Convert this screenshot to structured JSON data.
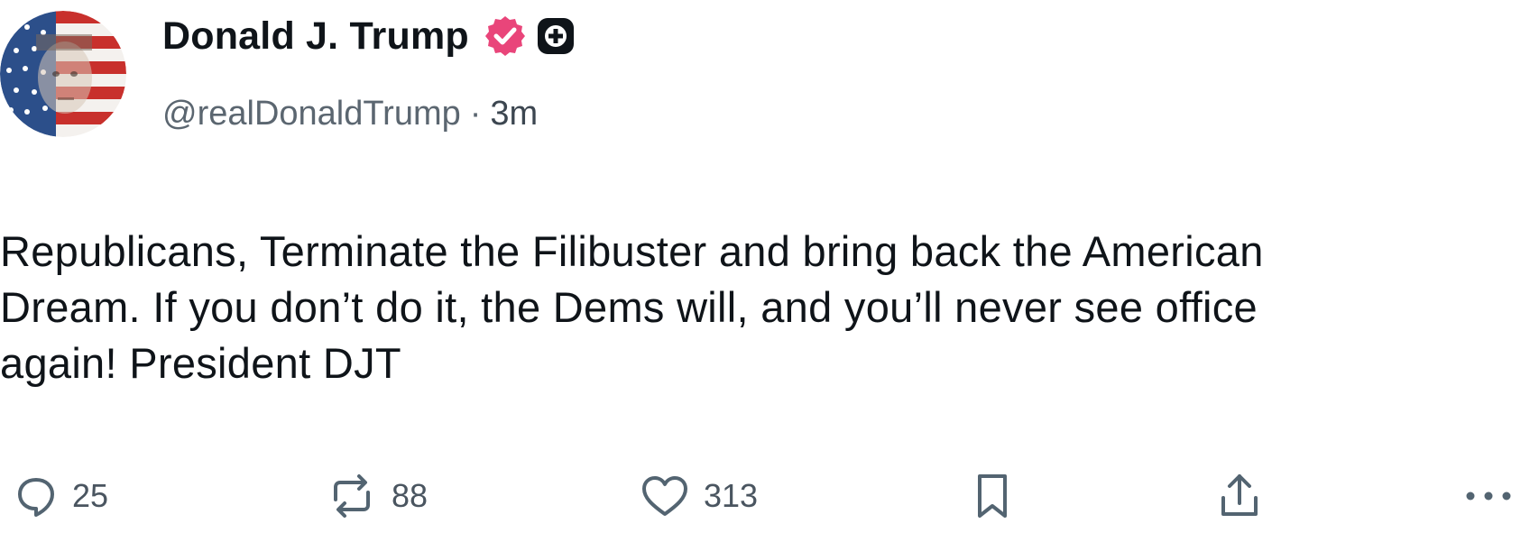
{
  "post": {
    "author": {
      "display_name": "Donald J. Trump",
      "handle": "@realDonaldTrump",
      "verified_icon": "verified-check-badge",
      "plus_icon": "plus-badge",
      "badge_color": "#e9457a"
    },
    "separator": "·",
    "time_ago": "3m",
    "text": "Republicans, Terminate the Filibuster and bring back the American\nDream. If you don’t do it, the Dems will, and you’ll never see office\nagain! President DJT"
  },
  "actions": {
    "reply": {
      "icon": "reply-bubble-icon",
      "count": "25"
    },
    "repost": {
      "icon": "repost-arrows-icon",
      "count": "88"
    },
    "like": {
      "icon": "heart-icon",
      "count": "313"
    },
    "bookmark": {
      "icon": "bookmark-icon"
    },
    "share": {
      "icon": "share-upload-icon"
    },
    "more": {
      "icon": "more-dots-icon"
    }
  }
}
